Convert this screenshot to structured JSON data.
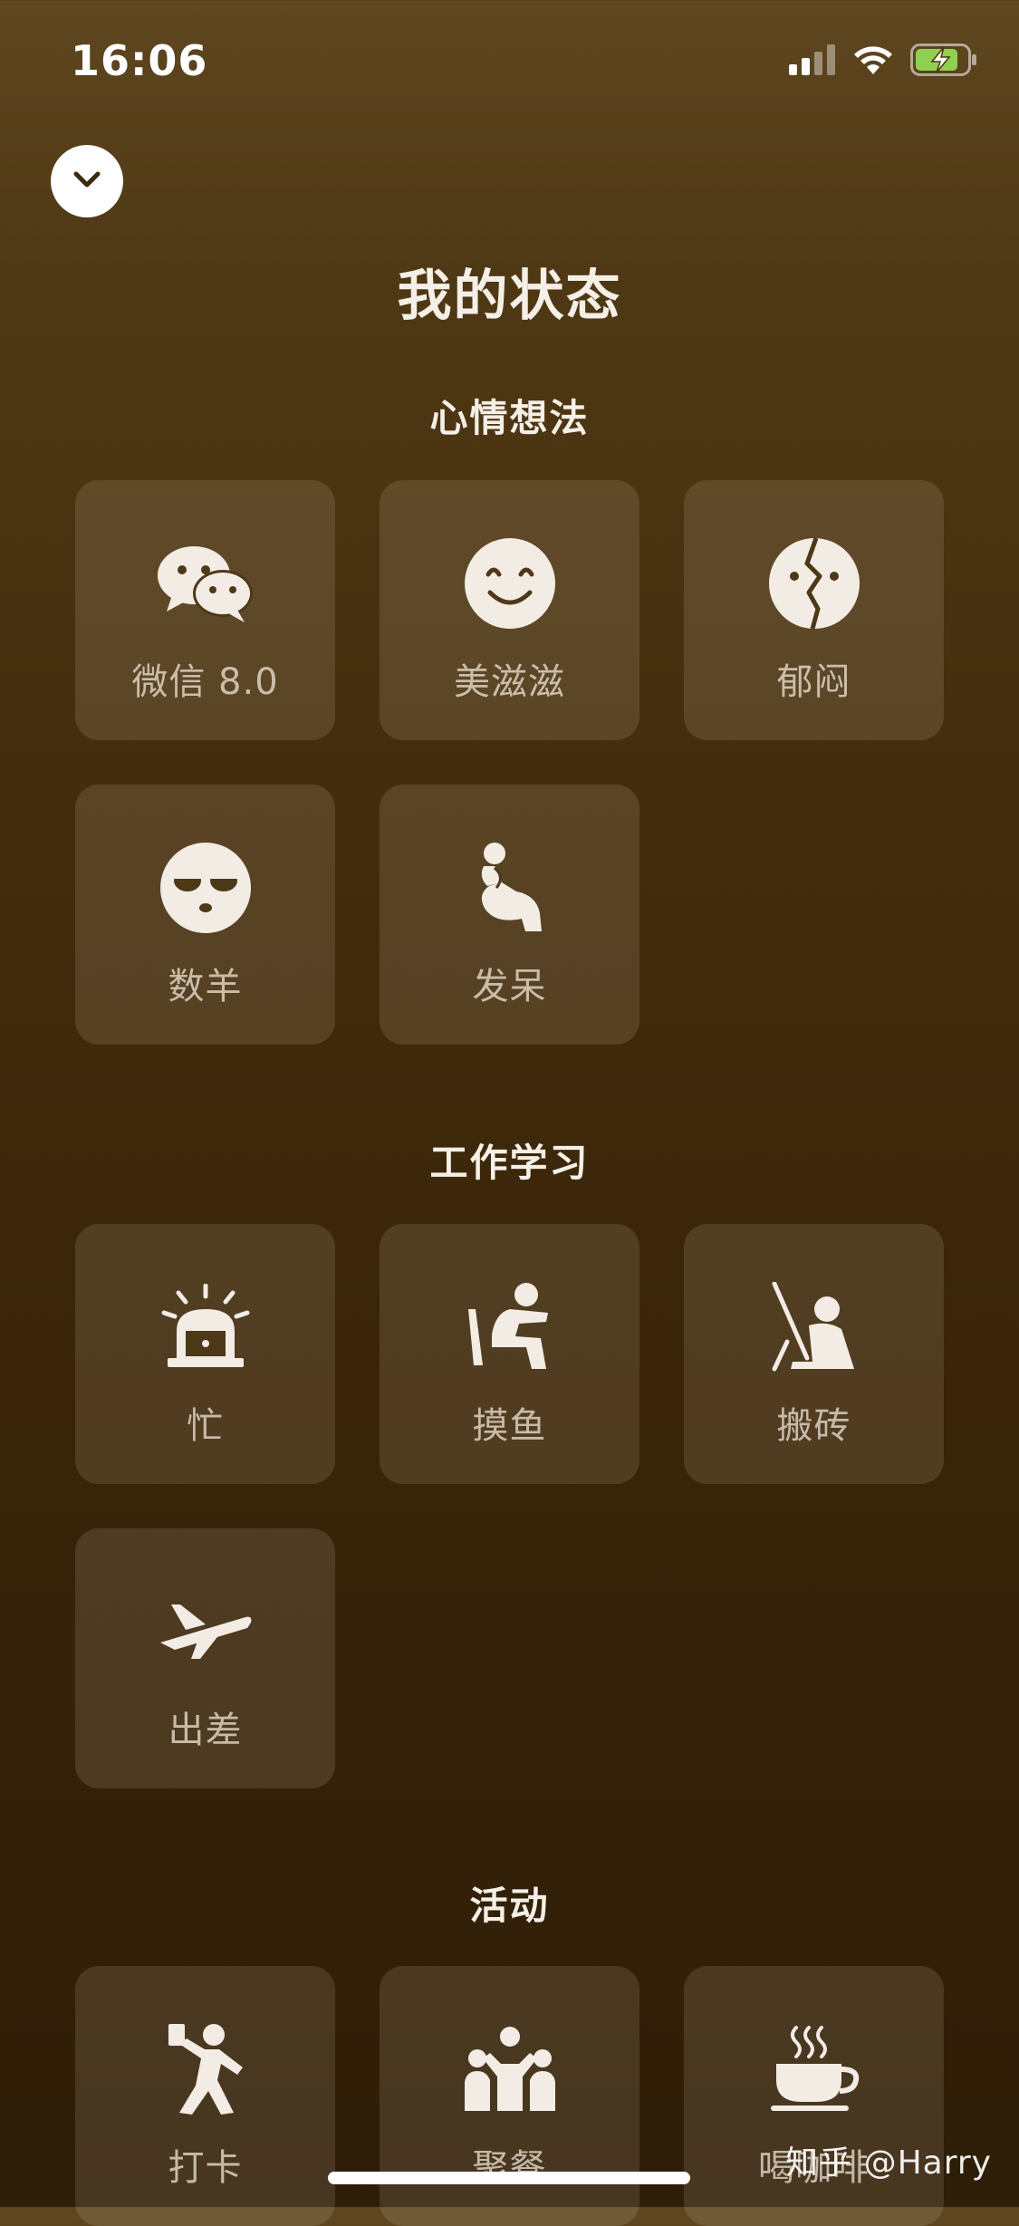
{
  "status_bar": {
    "time": "16:06",
    "icons": [
      "cellular-signal-icon",
      "wifi-icon",
      "battery-charging-icon"
    ]
  },
  "header": {
    "collapse_icon": "chevron-down-icon",
    "title": "我的状态"
  },
  "sections": [
    {
      "title": "心情想法",
      "items": [
        {
          "label": "微信 8.0",
          "icon": "wechat-icon"
        },
        {
          "label": "美滋滋",
          "icon": "smile-face-icon"
        },
        {
          "label": "郁闷",
          "icon": "broken-face-icon"
        },
        {
          "label": "数羊",
          "icon": "sleepy-face-icon"
        },
        {
          "label": "发呆",
          "icon": "thinker-icon"
        }
      ]
    },
    {
      "title": "工作学习",
      "items": [
        {
          "label": "忙",
          "icon": "alarm-siren-icon"
        },
        {
          "label": "摸鱼",
          "icon": "slacking-person-icon"
        },
        {
          "label": "搬砖",
          "icon": "laborer-icon"
        },
        {
          "label": "出差",
          "icon": "airplane-icon"
        }
      ]
    },
    {
      "title": "活动",
      "items": [
        {
          "label": "打卡",
          "icon": "check-in-person-icon"
        },
        {
          "label": "聚餐",
          "icon": "gathering-people-icon"
        },
        {
          "label": "喝咖啡",
          "icon": "coffee-cup-icon"
        }
      ]
    }
  ],
  "watermark": "知乎 @Harry",
  "colors": {
    "background_top": "#5e4620",
    "background_bottom": "#2e1d07",
    "tile_bg": "rgba(255,240,215,0.12)",
    "icon": "#f2ece4",
    "battery_green": "#8fd14f"
  }
}
